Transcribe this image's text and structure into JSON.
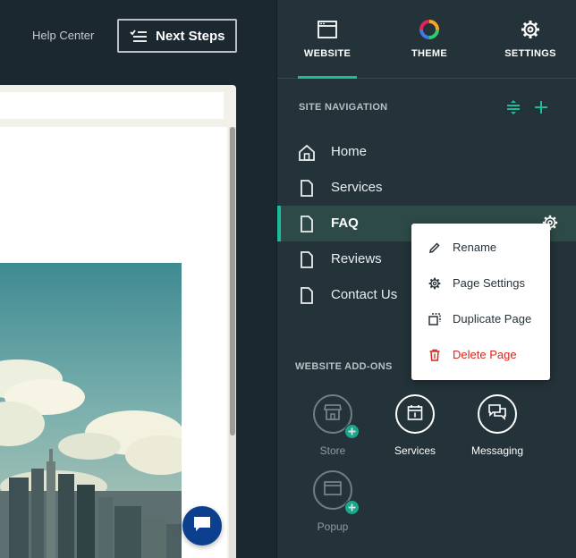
{
  "topbar": {
    "help_center": "Help Center",
    "next_steps": "Next Steps"
  },
  "tabs": [
    {
      "label": "WEBSITE",
      "icon": "browser-icon",
      "active": true
    },
    {
      "label": "THEME",
      "icon": "color-wheel-icon",
      "active": false
    },
    {
      "label": "SETTINGS",
      "icon": "gear-icon",
      "active": false
    }
  ],
  "site_navigation": {
    "title": "SITE NAVIGATION",
    "items": [
      {
        "label": "Home",
        "icon": "home-icon"
      },
      {
        "label": "Services",
        "icon": "page-icon"
      },
      {
        "label": "FAQ",
        "icon": "page-icon",
        "active": true
      },
      {
        "label": "Reviews",
        "icon": "page-icon"
      },
      {
        "label": "Contact Us",
        "icon": "page-icon"
      }
    ]
  },
  "context_menu": {
    "items": [
      {
        "label": "Rename",
        "icon": "pencil-icon"
      },
      {
        "label": "Page Settings",
        "icon": "gear-icon"
      },
      {
        "label": "Duplicate Page",
        "icon": "duplicate-icon"
      },
      {
        "label": "Delete Page",
        "icon": "trash-icon",
        "danger": true
      }
    ]
  },
  "addons": {
    "title": "WEBSITE ADD-ONS",
    "items": [
      {
        "label": "Store",
        "icon": "store-icon",
        "enabled": false
      },
      {
        "label": "Services",
        "icon": "calendar-icon",
        "enabled": true
      },
      {
        "label": "Messaging",
        "icon": "chat-icon",
        "enabled": true
      },
      {
        "label": "Popup",
        "icon": "popup-icon",
        "enabled": false
      }
    ]
  },
  "colors": {
    "accent": "#1bbc9b",
    "panel": "#233339",
    "danger": "#d8271c",
    "chat_button": "#0d3f8f"
  }
}
